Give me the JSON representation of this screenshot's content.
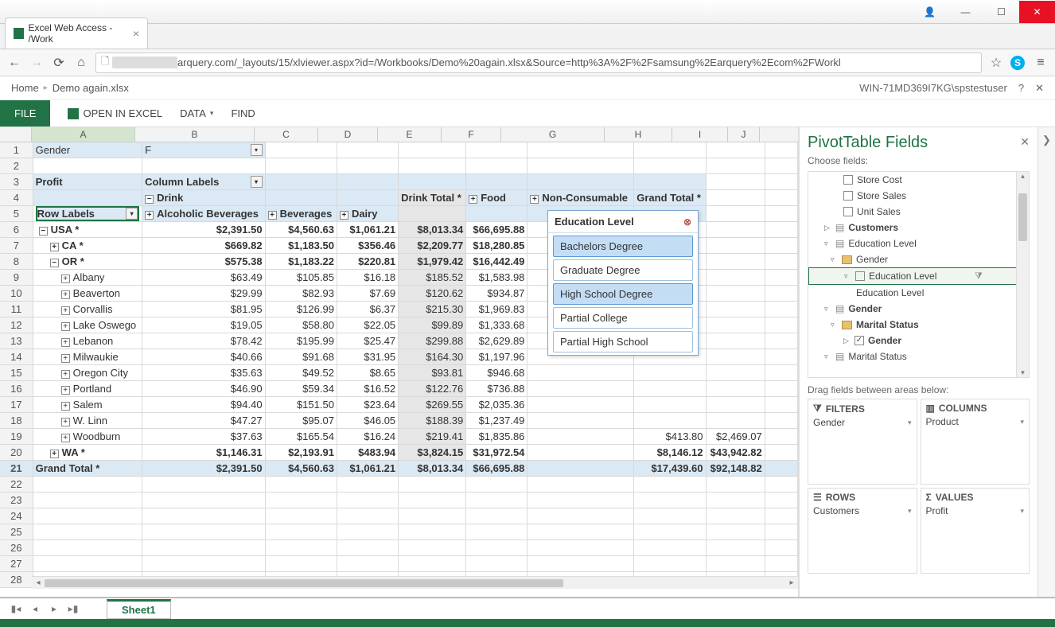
{
  "window": {
    "user_btn": "👤",
    "min": "—",
    "max": "☐",
    "close": "✕"
  },
  "browser": {
    "tab_title": "Excel Web Access - /Work",
    "tab_close": "×",
    "url_suffix": "arquery.com/_layouts/15/xlviewer.aspx?id=/Workbooks/Demo%20again.xlsx&Source=http%3A%2F%2Fsamsung%2Earquery%2Ecom%2FWorkl",
    "star": "☆",
    "menu": "≡"
  },
  "sp": {
    "home": "Home",
    "doc": "Demo again.xlsx",
    "user": "WIN-71MD369I7KG\\spstestuser",
    "help": "?",
    "close": "✕"
  },
  "ribbon": {
    "file": "FILE",
    "open": "OPEN IN EXCEL",
    "data": "DATA",
    "find": "FIND"
  },
  "cols": [
    "A",
    "B",
    "C",
    "D",
    "E",
    "F",
    "G",
    "H",
    "I",
    "J"
  ],
  "rownums": [
    "1",
    "2",
    "3",
    "4",
    "5",
    "6",
    "7",
    "8",
    "9",
    "10",
    "11",
    "12",
    "13",
    "14",
    "15",
    "16",
    "17",
    "18",
    "19",
    "20",
    "21",
    "22",
    "23",
    "24",
    "25",
    "26",
    "27",
    "28"
  ],
  "grid": {
    "gender_lbl": "Gender",
    "gender_val": "F",
    "profit_lbl": "Profit",
    "collabels": "Column Labels",
    "drink": "Drink",
    "rowlabels": "Row Labels",
    "h_alc": "Alcoholic Beverages",
    "h_bev": "Beverages",
    "h_dairy": "Dairy",
    "h_drinktot": "Drink Total *",
    "h_food": "Food",
    "h_noncons": "Non-Consumable",
    "h_grandtot": "Grand Total *",
    "rows": [
      {
        "lvl": 0,
        "exp": "−",
        "label": "USA *",
        "v": [
          "$2,391.50",
          "$4,560.63",
          "$1,061.21",
          "$8,013.34",
          "$66,695.88",
          "",
          "",
          ""
        ],
        "bold": true
      },
      {
        "lvl": 1,
        "exp": "+",
        "label": "CA *",
        "v": [
          "$669.82",
          "$1,183.50",
          "$356.46",
          "$2,209.77",
          "$18,280.85",
          "",
          "",
          ""
        ],
        "bold": true
      },
      {
        "lvl": 1,
        "exp": "−",
        "label": "OR *",
        "v": [
          "$575.38",
          "$1,183.22",
          "$220.81",
          "$1,979.42",
          "$16,442.49",
          "",
          "",
          ""
        ],
        "bold": true
      },
      {
        "lvl": 2,
        "exp": "+",
        "label": "Albany",
        "v": [
          "$63.49",
          "$105.85",
          "$16.18",
          "$185.52",
          "$1,583.98",
          "",
          "",
          ""
        ]
      },
      {
        "lvl": 2,
        "exp": "+",
        "label": "Beaverton",
        "v": [
          "$29.99",
          "$82.93",
          "$7.69",
          "$120.62",
          "$934.87",
          "",
          "",
          ""
        ]
      },
      {
        "lvl": 2,
        "exp": "+",
        "label": "Corvallis",
        "v": [
          "$81.95",
          "$126.99",
          "$6.37",
          "$215.30",
          "$1,969.83",
          "",
          "",
          ""
        ]
      },
      {
        "lvl": 2,
        "exp": "+",
        "label": "Lake Oswego",
        "v": [
          "$19.05",
          "$58.80",
          "$22.05",
          "$99.89",
          "$1,333.68",
          "",
          "",
          ""
        ]
      },
      {
        "lvl": 2,
        "exp": "+",
        "label": "Lebanon",
        "v": [
          "$78.42",
          "$195.99",
          "$25.47",
          "$299.88",
          "$2,629.89",
          "",
          "",
          ""
        ]
      },
      {
        "lvl": 2,
        "exp": "+",
        "label": "Milwaukie",
        "v": [
          "$40.66",
          "$91.68",
          "$31.95",
          "$164.30",
          "$1,197.96",
          "",
          "",
          ""
        ]
      },
      {
        "lvl": 2,
        "exp": "+",
        "label": "Oregon City",
        "v": [
          "$35.63",
          "$49.52",
          "$8.65",
          "$93.81",
          "$946.68",
          "",
          "",
          ""
        ]
      },
      {
        "lvl": 2,
        "exp": "+",
        "label": "Portland",
        "v": [
          "$46.90",
          "$59.34",
          "$16.52",
          "$122.76",
          "$736.88",
          "",
          "",
          ""
        ]
      },
      {
        "lvl": 2,
        "exp": "+",
        "label": "Salem",
        "v": [
          "$94.40",
          "$151.50",
          "$23.64",
          "$269.55",
          "$2,035.36",
          "",
          "",
          ""
        ]
      },
      {
        "lvl": 2,
        "exp": "+",
        "label": "W. Linn",
        "v": [
          "$47.27",
          "$95.07",
          "$46.05",
          "$188.39",
          "$1,237.49",
          "",
          "",
          ""
        ]
      },
      {
        "lvl": 2,
        "exp": "+",
        "label": "Woodburn",
        "v": [
          "$37.63",
          "$165.54",
          "$16.24",
          "$219.41",
          "$1,835.86",
          "",
          "$413.80",
          "$2,469.07"
        ]
      },
      {
        "lvl": 1,
        "exp": "+",
        "label": "WA *",
        "v": [
          "$1,146.31",
          "$2,193.91",
          "$483.94",
          "$3,824.15",
          "$31,972.54",
          "",
          "$8,146.12",
          "$43,942.82"
        ],
        "bold": true
      }
    ],
    "grandtotal": {
      "label": "Grand Total *",
      "v": [
        "$2,391.50",
        "$4,560.63",
        "$1,061.21",
        "$8,013.34",
        "$66,695.88",
        "",
        "$17,439.60",
        "$92,148.82"
      ]
    }
  },
  "slicer": {
    "title": "Education Level",
    "items": [
      {
        "label": "Bachelors Degree",
        "sel": true
      },
      {
        "label": "Graduate Degree",
        "sel": false
      },
      {
        "label": "High School Degree",
        "sel": true
      },
      {
        "label": "Partial College",
        "sel": false
      },
      {
        "label": "Partial High School",
        "sel": false
      }
    ]
  },
  "pivot": {
    "title": "PivotTable Fields",
    "choose": "Choose fields:",
    "f_storecost": "Store Cost",
    "f_storesales": "Store Sales",
    "f_unitsales": "Unit Sales",
    "f_customers": "Customers",
    "f_edulevel": "Education Level",
    "f_gender_dim": "Gender",
    "f_edulevel2": "Education Level",
    "f_edulevel3": "Education Level",
    "f_gender": "Gender",
    "f_marital": "Marital Status",
    "f_gender2": "Gender",
    "f_marital2": "Marital Status",
    "dragtxt": "Drag fields between areas below:",
    "a_filters": "FILTERS",
    "a_columns": "COLUMNS",
    "a_rows": "ROWS",
    "a_values": "VALUES",
    "i_gender": "Gender",
    "i_product": "Product",
    "i_customers": "Customers",
    "i_profit": "Profit"
  },
  "sheet": {
    "name": "Sheet1"
  }
}
